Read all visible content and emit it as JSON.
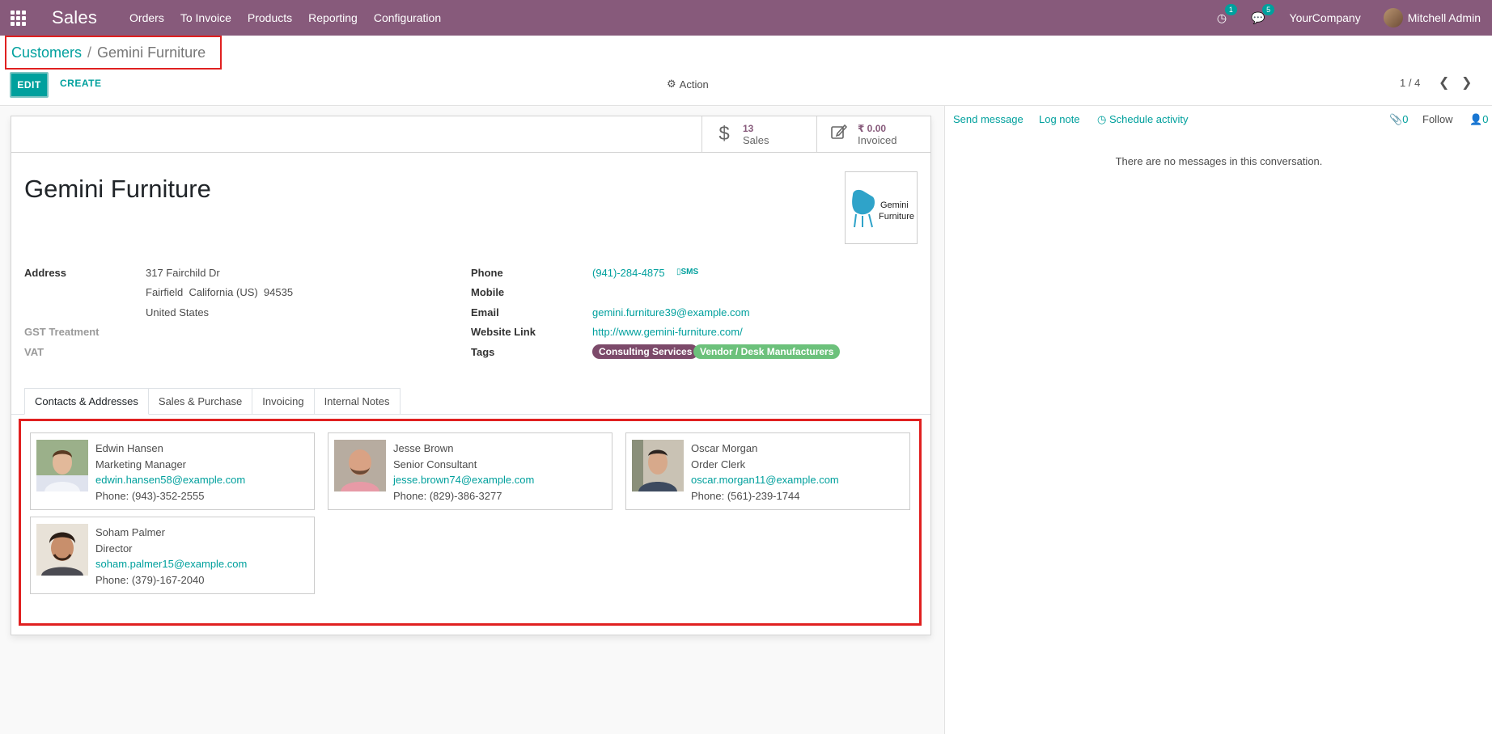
{
  "navbar": {
    "app_name": "Sales",
    "menu": [
      "Orders",
      "To Invoice",
      "Products",
      "Reporting",
      "Configuration"
    ],
    "activity_count": "1",
    "message_count": "5",
    "company": "YourCompany",
    "user": "Mitchell Admin"
  },
  "breadcrumb": {
    "parent": "Customers",
    "separator": "/",
    "current": "Gemini Furniture"
  },
  "control": {
    "edit_label": "EDIT",
    "create_label": "CREATE",
    "action_label": "Action",
    "pager": "1 / 4"
  },
  "stats": {
    "sales_value": "13",
    "sales_label": "Sales",
    "invoiced_value": "₹ 0.00",
    "invoiced_label": "Invoiced"
  },
  "partner": {
    "name": "Gemini Furniture",
    "logo_line1": "Gemini",
    "logo_line2": "Furniture"
  },
  "fields": {
    "address_label": "Address",
    "street": "317 Fairchild Dr",
    "city_line": "Fairfield  California (US)  94535",
    "country": "United States",
    "gst_label": "GST Treatment",
    "vat_label": "VAT",
    "phone_label": "Phone",
    "phone": "(941)-284-4875",
    "sms_label": "SMS",
    "mobile_label": "Mobile",
    "email_label": "Email",
    "email": "gemini.furniture39@example.com",
    "website_label": "Website Link",
    "website": "http://www.gemini-furniture.com/",
    "tags_label": "Tags",
    "tags": [
      "Consulting Services",
      "Vendor / Desk Manufacturers"
    ],
    "tag_colors": [
      "#7c4a6a",
      "#6cc17b"
    ]
  },
  "tabs": [
    "Contacts & Addresses",
    "Sales & Purchase",
    "Invoicing",
    "Internal Notes"
  ],
  "contacts": [
    {
      "name": "Edwin Hansen",
      "role": "Marketing Manager",
      "email": "edwin.hansen58@example.com",
      "phone": "Phone: (943)-352-2555"
    },
    {
      "name": "Jesse Brown",
      "role": "Senior Consultant",
      "email": "jesse.brown74@example.com",
      "phone": "Phone: (829)-386-3277"
    },
    {
      "name": "Oscar Morgan",
      "role": "Order Clerk",
      "email": "oscar.morgan11@example.com",
      "phone": "Phone: (561)-239-1744"
    },
    {
      "name": "Soham Palmer",
      "role": "Director",
      "email": "soham.palmer15@example.com",
      "phone": "Phone: (379)-167-2040"
    }
  ],
  "chatter": {
    "send_message": "Send message",
    "log_note": "Log note",
    "schedule_activity": "Schedule activity",
    "attachments": "0",
    "follow": "Follow",
    "followers": "0",
    "empty": "There are no messages in this conversation."
  }
}
